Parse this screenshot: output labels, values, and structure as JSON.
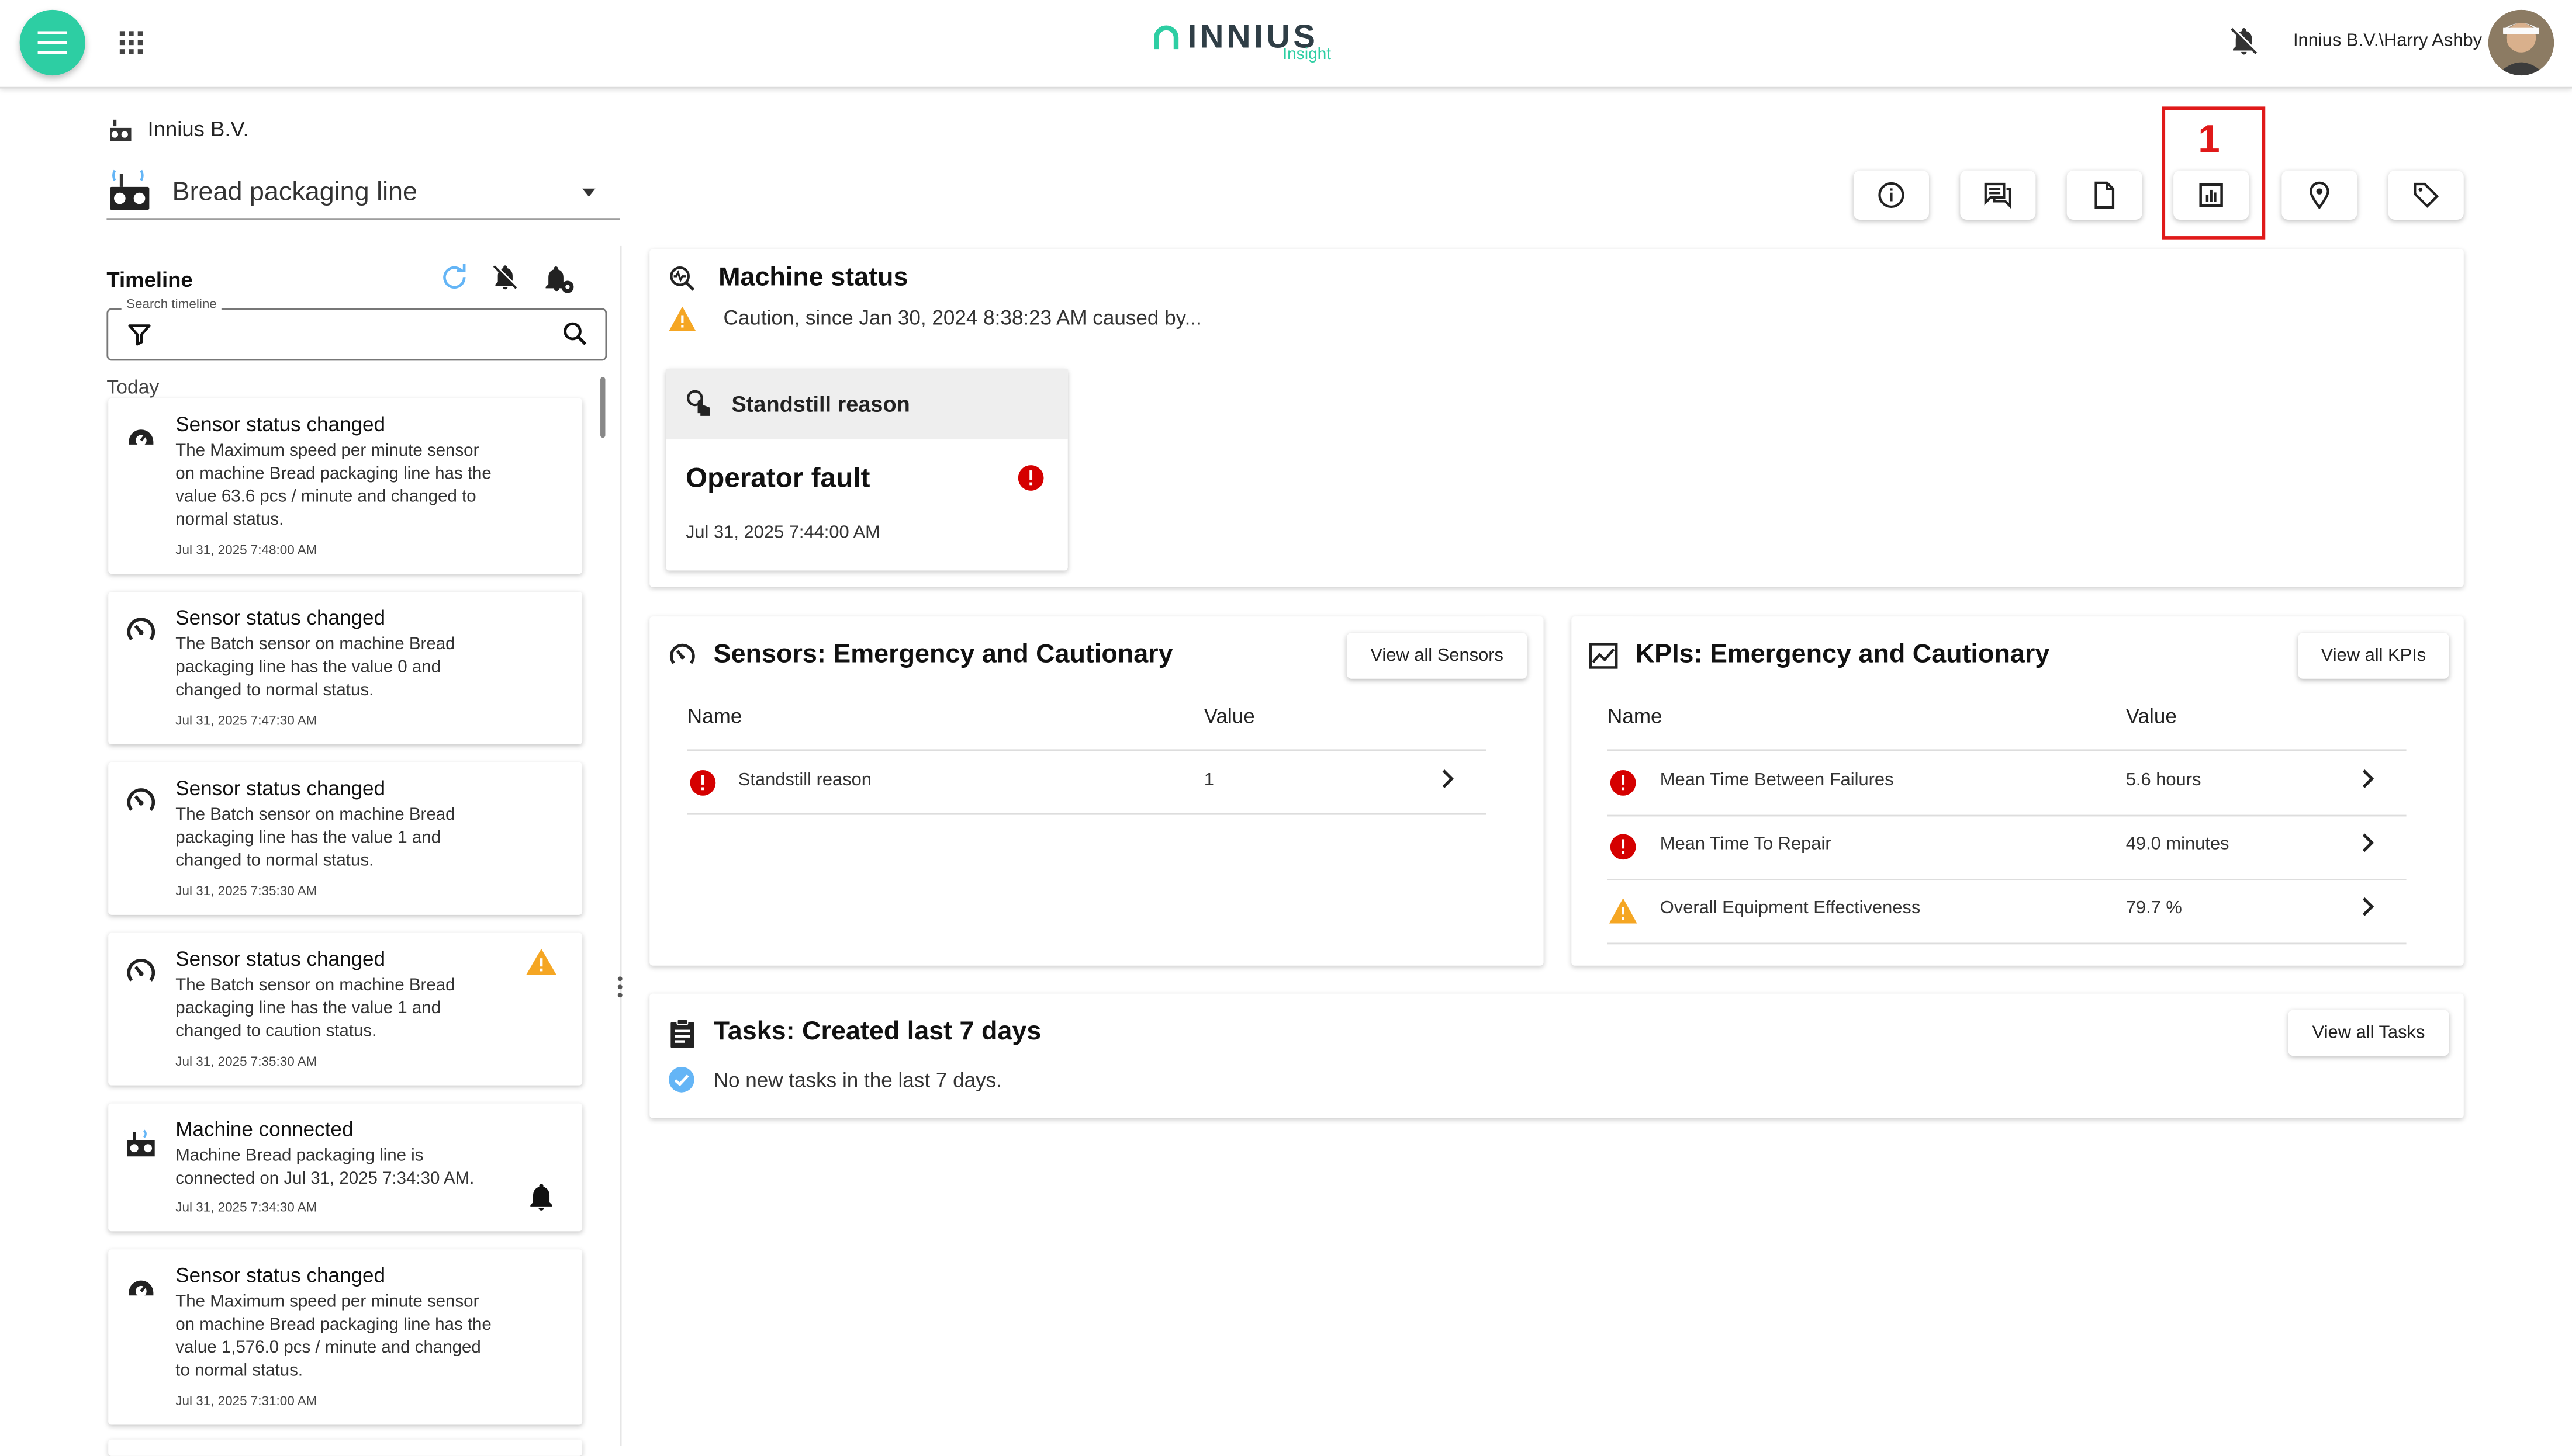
{
  "colors": {
    "brand": "#2dcea3",
    "error": "#d50000",
    "warning": "#f5a623",
    "info": "#64b5f6",
    "highlight": "#e01919"
  },
  "topbar": {
    "logo_text": "INNIUS",
    "logo_sub": "Insight",
    "user": "Innius B.V.\\Harry Ashby"
  },
  "header": {
    "org": "Innius B.V.",
    "machine": "Bread packaging line"
  },
  "toolbar": {
    "icons": [
      "info-icon",
      "chat-icon",
      "document-icon",
      "report-icon",
      "location-icon",
      "tag-icon"
    ],
    "highlight_number": "1"
  },
  "timeline": {
    "title": "Timeline",
    "search_label": "Search timeline",
    "search_value": "",
    "group_label": "Today",
    "items": [
      {
        "title": "Sensor status changed",
        "body": "The Maximum speed per minute sensor on machine Bread packaging line has the value 63.6 pcs / minute and changed to normal status.",
        "time": "Jul 31, 2025 7:48:00 AM",
        "icon": "speed-sensor-icon",
        "status": ""
      },
      {
        "title": "Sensor status changed",
        "body": "The Batch sensor on machine Bread packaging line has the value 0 and changed to normal status.",
        "time": "Jul 31, 2025 7:47:30 AM",
        "icon": "gauge-icon",
        "status": ""
      },
      {
        "title": "Sensor status changed",
        "body": "The Batch sensor on machine Bread packaging line has the value 1 and changed to normal status.",
        "time": "Jul 31, 2025 7:35:30 AM",
        "icon": "gauge-icon",
        "status": ""
      },
      {
        "title": "Sensor status changed",
        "body": "The Batch sensor on machine Bread packaging line has the value 1 and changed to caution status.",
        "time": "Jul 31, 2025 7:35:30 AM",
        "icon": "gauge-icon",
        "status": "warning-icon"
      },
      {
        "title": "Machine connected",
        "body": "Machine Bread packaging line is connected on Jul 31, 2025 7:34:30 AM.",
        "time": "Jul 31, 2025 7:34:30 AM",
        "icon": "machine-icon",
        "status": "bell-icon"
      },
      {
        "title": "Sensor status changed",
        "body": "The Maximum speed per minute sensor on machine Bread packaging line has the value 1,576.0 pcs / minute and changed to normal status.",
        "time": "Jul 31, 2025 7:31:00 AM",
        "icon": "speed-sensor-icon",
        "status": ""
      }
    ]
  },
  "machine_status": {
    "title": "Machine status",
    "caution_text": "Caution, since Jan 30, 2024 8:38:23 AM caused by...",
    "card_header": "Standstill reason",
    "card_value": "Operator fault",
    "card_time": "Jul 31, 2025 7:44:00 AM"
  },
  "sensors": {
    "title": "Sensors: Emergency and Cautionary",
    "button": "View all Sensors",
    "col_name": "Name",
    "col_value": "Value",
    "rows": [
      {
        "name": "Standstill reason",
        "value": "1",
        "status": "error"
      }
    ]
  },
  "kpis": {
    "title": "KPIs: Emergency and Cautionary",
    "button": "View all KPIs",
    "col_name": "Name",
    "col_value": "Value",
    "rows": [
      {
        "name": "Mean Time Between Failures",
        "value": "5.6 hours",
        "status": "error"
      },
      {
        "name": "Mean Time To Repair",
        "value": "49.0 minutes",
        "status": "error"
      },
      {
        "name": "Overall Equipment Effectiveness",
        "value": "79.7 %",
        "status": "warning"
      }
    ]
  },
  "tasks": {
    "title": "Tasks: Created last 7 days",
    "button": "View all Tasks",
    "empty_text": "No new tasks in the last 7 days."
  }
}
